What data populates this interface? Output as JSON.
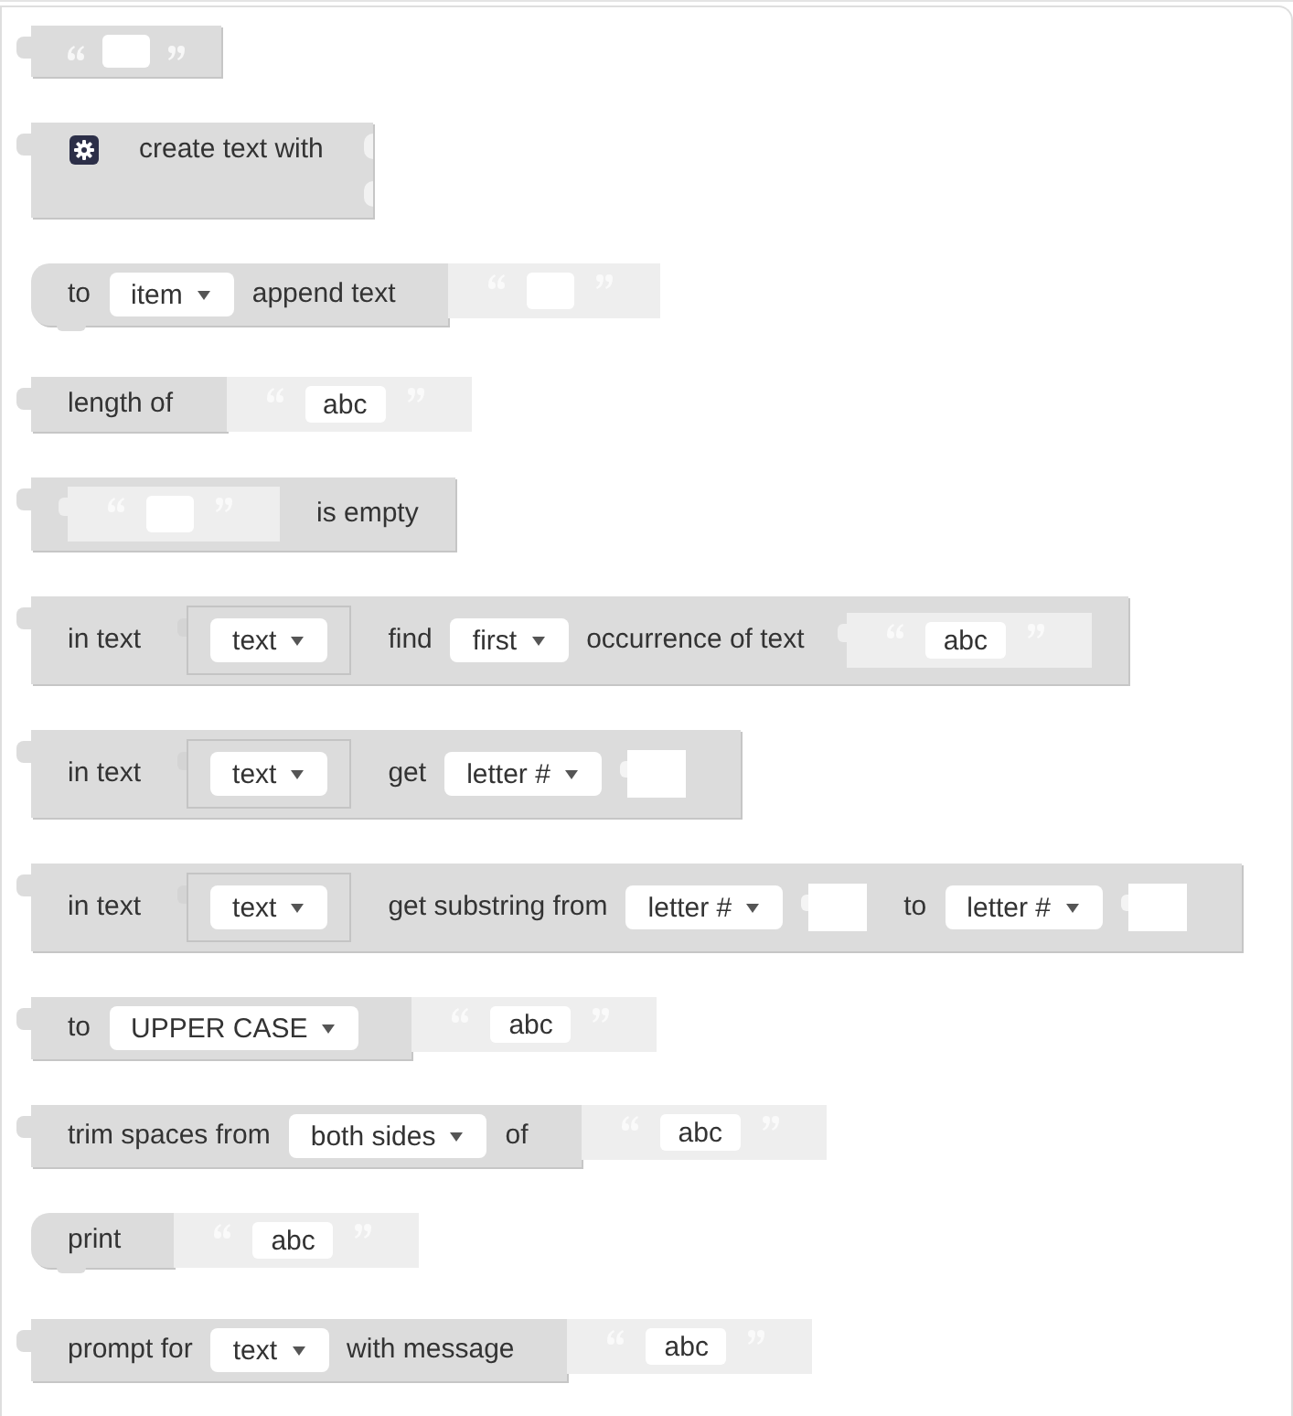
{
  "blocks": [
    {
      "kind": "value",
      "parts": [
        {
          "kind": "quoted_field"
        }
      ]
    },
    {
      "kind": "join",
      "parts": [
        {
          "kind": "mutator"
        },
        {
          "kind": "label",
          "text": "create text with"
        }
      ]
    },
    {
      "kind": "statement",
      "parts": [
        {
          "kind": "label",
          "text": "to"
        },
        {
          "kind": "dropdown",
          "text": "item"
        },
        {
          "kind": "label",
          "text": "append text"
        }
      ],
      "attached": {
        "kind": "string"
      }
    },
    {
      "kind": "value",
      "parts": [
        {
          "kind": "label",
          "text": "length of"
        }
      ],
      "attached": {
        "kind": "string",
        "text": "abc"
      }
    },
    {
      "kind": "value",
      "parts": [
        {
          "kind": "string"
        },
        {
          "kind": "label",
          "text": "is empty"
        }
      ]
    },
    {
      "kind": "value",
      "parts": [
        {
          "kind": "label",
          "text": "in text"
        },
        {
          "kind": "variable",
          "text": "text"
        },
        {
          "kind": "label",
          "text": "find"
        },
        {
          "kind": "dropdown",
          "text": "first"
        },
        {
          "kind": "label",
          "text": "occurrence of text"
        },
        {
          "kind": "string",
          "text": "abc"
        }
      ]
    },
    {
      "kind": "value",
      "parts": [
        {
          "kind": "label",
          "text": "in text"
        },
        {
          "kind": "variable",
          "text": "text"
        },
        {
          "kind": "label",
          "text": "get"
        },
        {
          "kind": "dropdown",
          "text": "letter #"
        },
        {
          "kind": "socket"
        }
      ]
    },
    {
      "kind": "value",
      "parts": [
        {
          "kind": "label",
          "text": "in text"
        },
        {
          "kind": "variable",
          "text": "text"
        },
        {
          "kind": "label",
          "text": "get substring from"
        },
        {
          "kind": "dropdown",
          "text": "letter #"
        },
        {
          "kind": "socket"
        },
        {
          "kind": "label",
          "text": "to"
        },
        {
          "kind": "dropdown",
          "text": "letter #"
        },
        {
          "kind": "socket"
        }
      ]
    },
    {
      "kind": "value",
      "parts": [
        {
          "kind": "label",
          "text": "to"
        },
        {
          "kind": "dropdown",
          "text": "UPPER CASE"
        }
      ],
      "attached": {
        "kind": "string",
        "text": "abc"
      }
    },
    {
      "kind": "value",
      "parts": [
        {
          "kind": "label",
          "text": "trim spaces from"
        },
        {
          "kind": "dropdown",
          "text": "both sides"
        },
        {
          "kind": "label",
          "text": "of"
        }
      ],
      "attached": {
        "kind": "string",
        "text": "abc"
      }
    },
    {
      "kind": "statement",
      "parts": [
        {
          "kind": "label",
          "text": "print"
        }
      ],
      "attached": {
        "kind": "string",
        "text": "abc"
      }
    },
    {
      "kind": "value",
      "parts": [
        {
          "kind": "label",
          "text": "prompt for"
        },
        {
          "kind": "dropdown",
          "text": "text"
        },
        {
          "kind": "label",
          "text": "with message"
        }
      ],
      "attached": {
        "kind": "string",
        "text": "abc"
      }
    }
  ]
}
